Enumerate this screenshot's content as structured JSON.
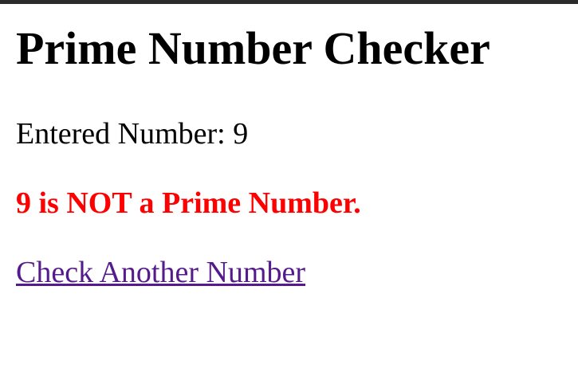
{
  "page": {
    "title": "Prime Number Checker",
    "entered_label": "Entered Number: 9",
    "result_text": "9 is NOT a Prime Number.",
    "link_text": "Check Another Number"
  },
  "colors": {
    "result": "#ff0000",
    "link": "#551a8b"
  }
}
